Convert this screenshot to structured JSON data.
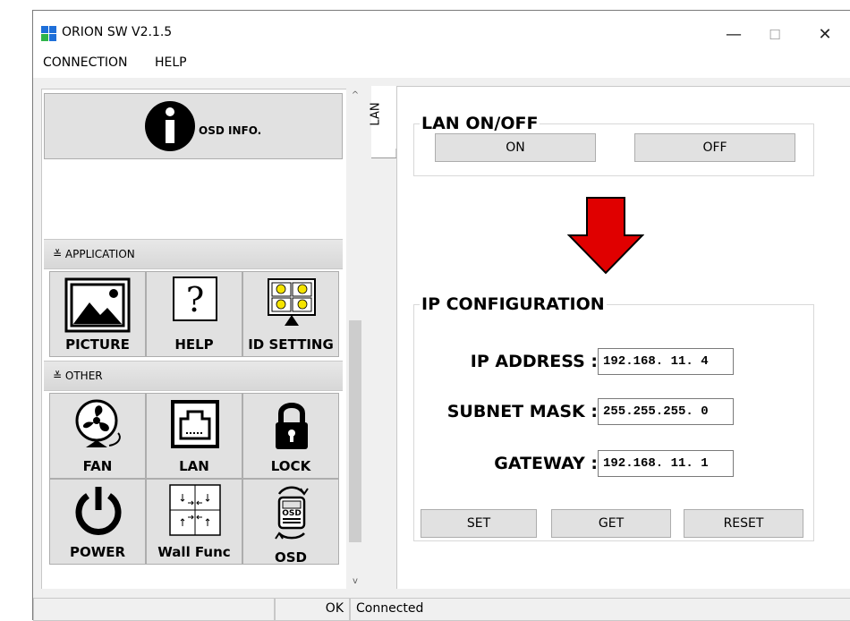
{
  "window": {
    "title": "ORION SW V2.1.5",
    "controls": {
      "minimize": "—",
      "maximize": "☐",
      "close": "✕"
    }
  },
  "menu": [
    "CONNECTION",
    "HELP"
  ],
  "sidebar": {
    "osd_info_label": "OSD INFO.",
    "sections": [
      {
        "label": "APPLICATION",
        "items": [
          "PICTURE",
          "HELP",
          "ID SETTING"
        ]
      },
      {
        "label": "OTHER",
        "items": [
          "FAN",
          "LAN",
          "LOCK",
          "POWER",
          "Wall Func",
          "OSD"
        ]
      }
    ],
    "scroll_up": "^",
    "scroll_down": "v"
  },
  "tab": {
    "label": "LAN"
  },
  "lan_onoff": {
    "title": "LAN ON/OFF",
    "on_label": "ON",
    "off_label": "OFF"
  },
  "ip_config": {
    "title": "IP CONFIGURATION",
    "fields": [
      {
        "label": "IP ADDRESS :",
        "value": "192.168. 11.  4"
      },
      {
        "label": "SUBNET MASK :",
        "value": "255.255.255.  0"
      },
      {
        "label": "GATEWAY :",
        "value": "192.168. 11.  1"
      }
    ],
    "buttons": [
      "SET",
      "GET",
      "RESET"
    ]
  },
  "status": {
    "cell1": "",
    "cell2": "OK",
    "cell3": "Connected"
  },
  "colors": {
    "arrow": "#e00000",
    "icon_blue": "#1e6fd9",
    "icon_green": "#2fb54a"
  }
}
